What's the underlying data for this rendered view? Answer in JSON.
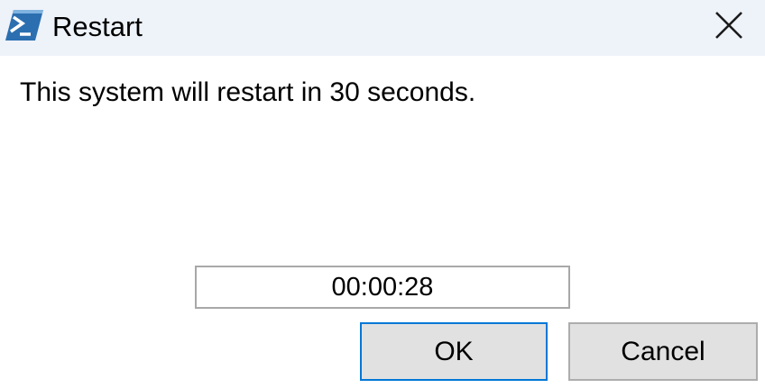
{
  "window": {
    "title": "Restart",
    "app_icon": "powershell-icon",
    "close_icon": "close-icon"
  },
  "message": "This system will restart in 30 seconds.",
  "countdown": {
    "value": "00:00:28"
  },
  "buttons": {
    "ok_label": "OK",
    "cancel_label": "Cancel"
  },
  "colors": {
    "titlebar_bg": "#eef2f9",
    "focus_border": "#0078d7",
    "button_bg": "#e1e1e1",
    "icon_blue": "#2b6fb0"
  }
}
